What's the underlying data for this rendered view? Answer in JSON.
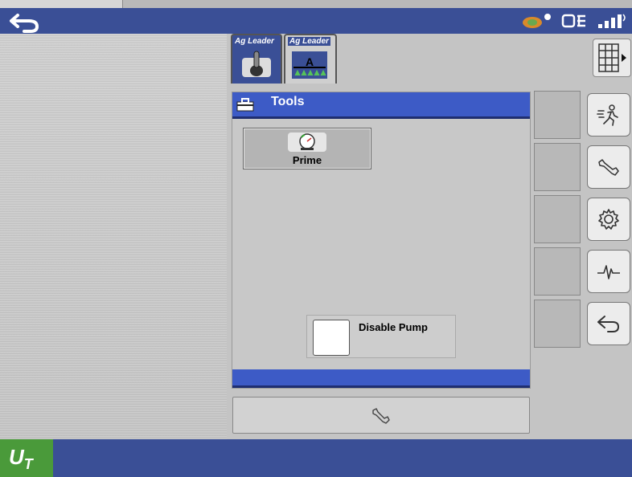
{
  "window": {
    "back_icon": "back-arrow-icon",
    "status_icons": [
      "gps-satellite-icon",
      "connection-icon",
      "signal-strength-icon"
    ]
  },
  "tabs": [
    {
      "label": "Ag Leader",
      "icon": "toggle-switch-icon"
    },
    {
      "label": "Ag Leader",
      "icon": "sprayer-boom-icon"
    }
  ],
  "grid_button_icon": "grid-menu-icon",
  "tools": {
    "title": "Tools",
    "icon": "toolbox-icon",
    "prime_label": "Prime",
    "prime_icon": "pressure-gauge-icon",
    "disable_pump_label": "Disable Pump"
  },
  "bottom": {
    "wrench_icon": "wrench-icon",
    "ut_label": "U",
    "ut_sub": "T"
  },
  "side_buttons": [
    "run-icon",
    "wrench-icon",
    "settings-gear-icon",
    "diagnostics-icon",
    "back-arrow-icon"
  ],
  "colors": {
    "topbar": "#3a4f96",
    "header": "#3d5bc6",
    "ut_badge": "#4a9a3a"
  }
}
